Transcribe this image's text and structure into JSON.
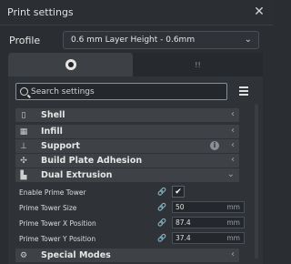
{
  "window": {
    "title": "Print settings"
  },
  "profile": {
    "label": "Profile",
    "value": "0.6 mm Layer Height - 0.6mm"
  },
  "tabs": [
    {
      "name": "extruder-1",
      "active": true
    },
    {
      "name": "extruder-2",
      "label": "!!",
      "active": false
    }
  ],
  "search": {
    "placeholder": "Search settings"
  },
  "categories": {
    "shell": {
      "label": "Shell"
    },
    "infill": {
      "label": "Infill"
    },
    "support": {
      "label": "Support"
    },
    "build_plate_adhesion": {
      "label": "Build Plate Adhesion"
    },
    "dual_extrusion": {
      "label": "Dual Extrusion"
    },
    "special_modes": {
      "label": "Special Modes"
    }
  },
  "settings": {
    "enable_prime_tower": {
      "label": "Enable Prime Tower",
      "checked": true
    },
    "prime_tower_size": {
      "label": "Prime Tower Size",
      "value": "50",
      "unit": "mm"
    },
    "prime_tower_x": {
      "label": "Prime Tower X Position",
      "value": "87.4",
      "unit": "mm"
    },
    "prime_tower_y": {
      "label": "Prime Tower Y Position",
      "value": "37.4",
      "unit": "mm"
    }
  }
}
